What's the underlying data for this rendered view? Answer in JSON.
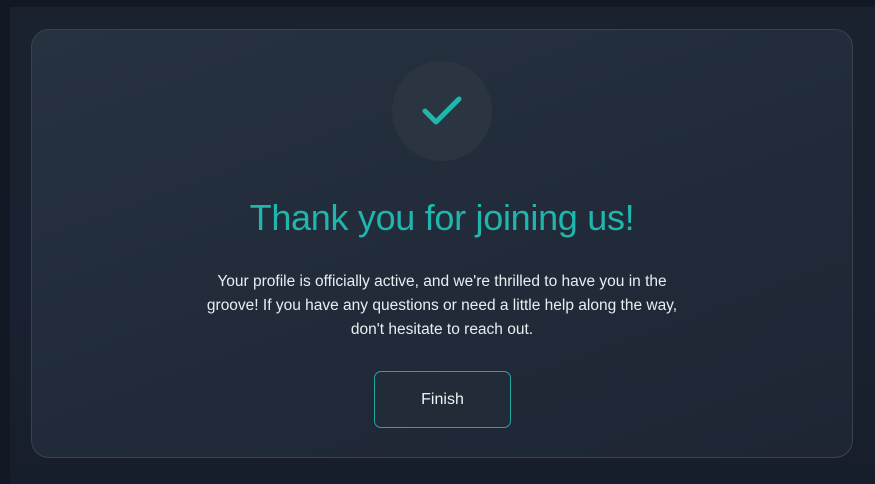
{
  "dialog": {
    "icon": "checkmark-icon",
    "title": "Thank you for joining us!",
    "message": "Your profile is officially active, and we're thrilled to have you in the groove! If you have any questions or need a little help along the way, don't hesitate to reach out.",
    "finish_label": "Finish"
  },
  "colors": {
    "accent": "#1fb6ad",
    "background": "#1a2230",
    "card": "#242e3c",
    "text": "#e9edf2"
  }
}
